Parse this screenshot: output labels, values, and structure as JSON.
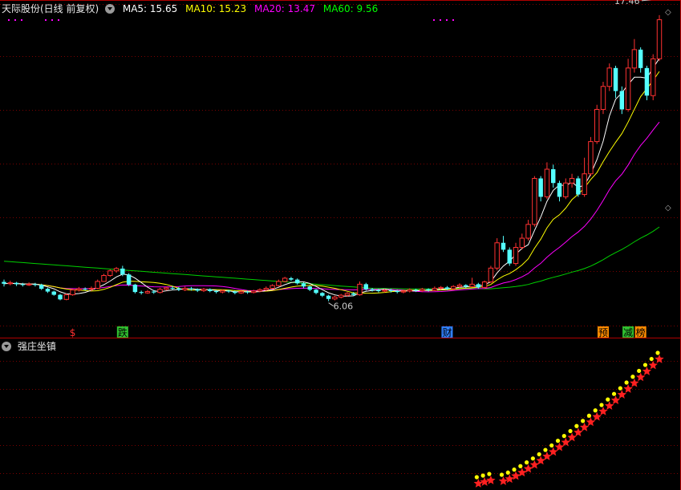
{
  "header": {
    "title": "天际股份(日线 前复权)",
    "ma": [
      {
        "label": "MA5: 15.65",
        "color": "#ffffff"
      },
      {
        "label": "MA10: 15.23",
        "color": "#ffff00"
      },
      {
        "label": "MA20: 13.47",
        "color": "#ff00ff"
      },
      {
        "label": "MA60: 9.56",
        "color": "#00ff00"
      }
    ]
  },
  "indicator": {
    "title": "强庄坐镇"
  },
  "chart_data": {
    "type": "candlestick",
    "y_range": [
      5.0,
      18.6
    ],
    "high_label": "17.46",
    "low_label": "6.06",
    "markers": [
      {
        "text": "$",
        "color": "#ff3030",
        "index": 11
      },
      {
        "text": "跌",
        "color": "#30c030",
        "index": 19
      },
      {
        "text": "财",
        "color": "#3080ff",
        "index": 71
      },
      {
        "text": "预",
        "color": "#ff8c00",
        "index": 96
      },
      {
        "text": "减",
        "color": "#30c030",
        "index": 100
      },
      {
        "text": "榜",
        "color": "#ff8c00",
        "index": 102
      }
    ],
    "candles": [
      [
        6.9,
        6.82,
        7.0,
        6.7
      ],
      [
        6.82,
        6.86,
        6.95,
        6.75
      ],
      [
        6.86,
        6.8,
        6.9,
        6.72
      ],
      [
        6.8,
        6.77,
        6.86,
        6.7
      ],
      [
        6.77,
        6.8,
        6.88,
        6.72
      ],
      [
        6.8,
        6.78,
        6.86,
        6.7
      ],
      [
        6.78,
        6.6,
        6.82,
        6.55
      ],
      [
        6.6,
        6.48,
        6.65,
        6.42
      ],
      [
        6.48,
        6.34,
        6.52,
        6.3
      ],
      [
        6.34,
        6.14,
        6.38,
        6.1
      ],
      [
        6.14,
        6.34,
        6.4,
        6.1
      ],
      [
        6.34,
        6.55,
        6.6,
        6.3
      ],
      [
        6.55,
        6.6,
        6.68,
        6.48
      ],
      [
        6.6,
        6.58,
        6.66,
        6.52
      ],
      [
        6.58,
        6.62,
        6.7,
        6.5
      ],
      [
        6.62,
        6.92,
        7.0,
        6.58
      ],
      [
        6.92,
        7.18,
        7.25,
        6.9
      ],
      [
        7.18,
        7.38,
        7.45,
        7.12
      ],
      [
        7.38,
        7.48,
        7.55,
        7.3
      ],
      [
        7.48,
        7.22,
        7.6,
        7.15
      ],
      [
        7.22,
        6.78,
        7.28,
        6.72
      ],
      [
        6.78,
        6.46,
        6.82,
        6.4
      ],
      [
        6.46,
        6.42,
        6.52,
        6.35
      ],
      [
        6.42,
        6.48,
        6.55,
        6.38
      ],
      [
        6.48,
        6.44,
        6.55,
        6.38
      ],
      [
        6.44,
        6.58,
        6.64,
        6.4
      ],
      [
        6.58,
        6.64,
        6.7,
        6.52
      ],
      [
        6.64,
        6.62,
        6.72,
        6.55
      ],
      [
        6.62,
        6.56,
        6.68,
        6.5
      ],
      [
        6.56,
        6.62,
        6.7,
        6.5
      ],
      [
        6.62,
        6.58,
        6.68,
        6.52
      ],
      [
        6.58,
        6.52,
        6.62,
        6.46
      ],
      [
        6.52,
        6.58,
        6.64,
        6.46
      ],
      [
        6.58,
        6.5,
        6.62,
        6.45
      ],
      [
        6.5,
        6.46,
        6.55,
        6.4
      ],
      [
        6.46,
        6.52,
        6.58,
        6.4
      ],
      [
        6.52,
        6.48,
        6.56,
        6.42
      ],
      [
        6.48,
        6.42,
        6.52,
        6.36
      ],
      [
        6.42,
        6.48,
        6.55,
        6.38
      ],
      [
        6.48,
        6.44,
        6.52,
        6.38
      ],
      [
        6.44,
        6.5,
        6.56,
        6.4
      ],
      [
        6.5,
        6.56,
        6.62,
        6.45
      ],
      [
        6.56,
        6.62,
        6.7,
        6.5
      ],
      [
        6.62,
        6.74,
        6.8,
        6.58
      ],
      [
        6.74,
        6.92,
        7.0,
        6.7
      ],
      [
        6.92,
        7.06,
        7.12,
        6.88
      ],
      [
        7.06,
        7.0,
        7.12,
        6.94
      ],
      [
        7.0,
        6.84,
        7.05,
        6.78
      ],
      [
        6.84,
        6.7,
        6.88,
        6.62
      ],
      [
        6.7,
        6.56,
        6.74,
        6.5
      ],
      [
        6.56,
        6.42,
        6.6,
        6.36
      ],
      [
        6.42,
        6.3,
        6.46,
        6.24
      ],
      [
        6.3,
        6.16,
        6.34,
        6.06
      ],
      [
        6.16,
        6.24,
        6.3,
        6.1
      ],
      [
        6.24,
        6.32,
        6.38,
        6.18
      ],
      [
        6.32,
        6.4,
        6.46,
        6.26
      ],
      [
        6.4,
        6.34,
        6.46,
        6.28
      ],
      [
        6.34,
        6.8,
        6.92,
        6.3
      ],
      [
        6.8,
        6.58,
        6.86,
        6.52
      ],
      [
        6.58,
        6.54,
        6.64,
        6.48
      ],
      [
        6.54,
        6.5,
        6.6,
        6.44
      ],
      [
        6.5,
        6.54,
        6.6,
        6.44
      ],
      [
        6.54,
        6.5,
        6.6,
        6.44
      ],
      [
        6.5,
        6.46,
        6.56,
        6.4
      ],
      [
        6.46,
        6.5,
        6.56,
        6.4
      ],
      [
        6.5,
        6.56,
        6.62,
        6.44
      ],
      [
        6.56,
        6.52,
        6.6,
        6.46
      ],
      [
        6.52,
        6.58,
        6.64,
        6.46
      ],
      [
        6.58,
        6.54,
        6.62,
        6.48
      ],
      [
        6.54,
        6.62,
        6.7,
        6.5
      ],
      [
        6.62,
        6.66,
        6.72,
        6.56
      ],
      [
        6.66,
        6.6,
        6.72,
        6.54
      ],
      [
        6.6,
        6.7,
        6.76,
        6.54
      ],
      [
        6.7,
        6.76,
        6.84,
        6.64
      ],
      [
        6.76,
        6.7,
        6.8,
        6.62
      ],
      [
        6.7,
        6.8,
        7.08,
        6.66
      ],
      [
        6.8,
        6.66,
        6.86,
        6.6
      ],
      [
        6.66,
        6.9,
        6.96,
        6.6
      ],
      [
        6.9,
        7.5,
        7.6,
        6.86
      ],
      [
        7.5,
        8.6,
        8.8,
        7.4
      ],
      [
        8.6,
        8.3,
        8.9,
        8.2
      ],
      [
        8.3,
        7.7,
        8.4,
        7.6
      ],
      [
        7.7,
        8.4,
        8.6,
        7.6
      ],
      [
        8.4,
        8.8,
        9.0,
        8.3
      ],
      [
        8.8,
        9.4,
        9.6,
        8.7
      ],
      [
        9.4,
        11.4,
        11.5,
        9.3
      ],
      [
        11.4,
        10.6,
        11.5,
        10.4
      ],
      [
        10.6,
        11.8,
        12.1,
        10.5
      ],
      [
        11.8,
        11.2,
        12.0,
        11.0
      ],
      [
        11.2,
        10.6,
        11.3,
        10.4
      ],
      [
        10.6,
        11.2,
        11.4,
        10.5
      ],
      [
        11.2,
        11.4,
        11.6,
        11.0
      ],
      [
        11.4,
        10.7,
        11.5,
        10.6
      ],
      [
        10.7,
        11.6,
        12.3,
        10.6
      ],
      [
        11.6,
        13.0,
        13.2,
        11.5
      ],
      [
        13.0,
        14.4,
        14.6,
        12.9
      ],
      [
        14.4,
        15.4,
        15.6,
        14.2
      ],
      [
        15.4,
        16.2,
        16.4,
        15.2
      ],
      [
        16.2,
        15.2,
        16.3,
        14.9
      ],
      [
        15.2,
        14.4,
        15.4,
        14.2
      ],
      [
        14.4,
        16.2,
        16.6,
        14.3
      ],
      [
        16.2,
        17.0,
        17.46,
        16.0
      ],
      [
        17.0,
        16.2,
        17.1,
        16.0
      ],
      [
        16.2,
        15.0,
        16.3,
        14.8
      ],
      [
        15.0,
        16.6,
        16.8,
        14.8
      ],
      [
        16.6,
        18.3,
        18.5,
        16.5
      ]
    ]
  }
}
